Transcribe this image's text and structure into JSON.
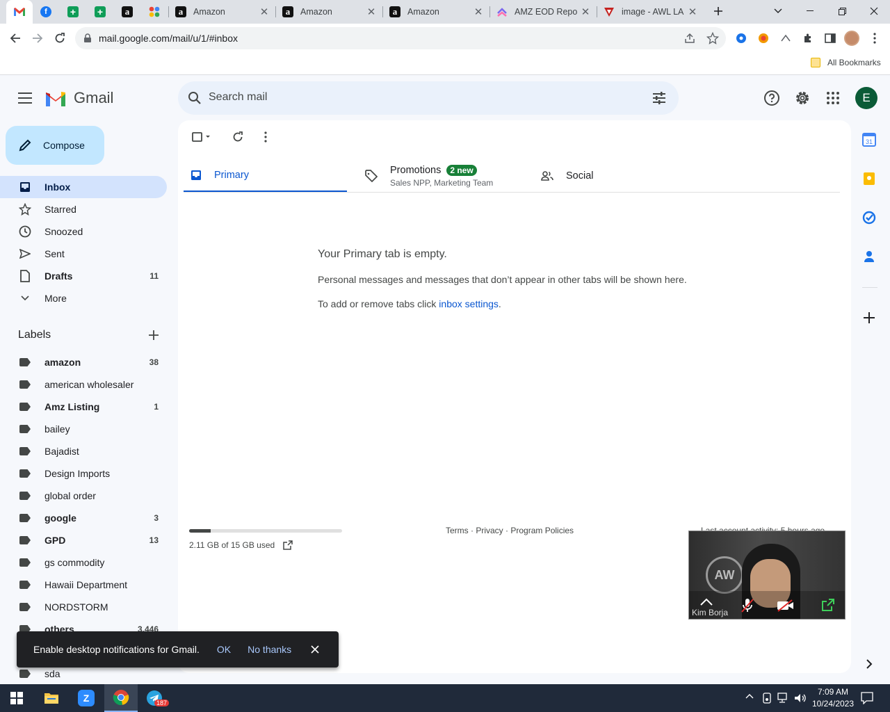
{
  "browser": {
    "tabs": [
      {
        "title": "Amazon",
        "icon": "amazon-icon"
      },
      {
        "title": "Amazon",
        "icon": "amazon-icon"
      },
      {
        "title": "Amazon",
        "icon": "amazon-icon"
      },
      {
        "title": "AMZ EOD Repo",
        "icon": "clickup-icon"
      },
      {
        "title": "image - AWL LA",
        "icon": "awl-icon"
      }
    ],
    "pinned_tabs": [
      "gmail-icon",
      "facebook-icon",
      "sheets-icon",
      "sheets-icon",
      "amazon-icon",
      "google-apps-icon"
    ],
    "url": "mail.google.com/mail/u/1/#inbox",
    "bookmarks_label": "All Bookmarks"
  },
  "gmail": {
    "logo_text": "Gmail",
    "search_placeholder": "Search mail",
    "avatar_letter": "E",
    "compose_label": "Compose",
    "nav": [
      {
        "label": "Inbox",
        "count": "",
        "icon": "inbox-icon",
        "active": true
      },
      {
        "label": "Starred",
        "count": "",
        "icon": "star-icon"
      },
      {
        "label": "Snoozed",
        "count": "",
        "icon": "clock-icon"
      },
      {
        "label": "Sent",
        "count": "",
        "icon": "send-icon"
      },
      {
        "label": "Drafts",
        "count": "11",
        "icon": "draft-icon",
        "bold": true
      },
      {
        "label": "More",
        "count": "",
        "icon": "chevron-down-icon"
      }
    ],
    "labels_title": "Labels",
    "labels": [
      {
        "label": "amazon",
        "count": "38",
        "bold": true
      },
      {
        "label": "american wholesaler",
        "count": ""
      },
      {
        "label": "Amz Listing",
        "count": "1",
        "bold": true
      },
      {
        "label": "bailey",
        "count": ""
      },
      {
        "label": "Bajadist",
        "count": ""
      },
      {
        "label": "Design Imports",
        "count": ""
      },
      {
        "label": "global order",
        "count": ""
      },
      {
        "label": "google",
        "count": "3",
        "bold": true
      },
      {
        "label": "GPD",
        "count": "13",
        "bold": true
      },
      {
        "label": "gs commodity",
        "count": ""
      },
      {
        "label": "Hawaii Department",
        "count": ""
      },
      {
        "label": "NORDSTORM",
        "count": ""
      },
      {
        "label": "others",
        "count": "3,446",
        "bold": true
      },
      {
        "label": "sda",
        "count": ""
      }
    ],
    "tabs": {
      "primary": "Primary",
      "promotions": "Promotions",
      "promotions_badge": "2 new",
      "promotions_sub": "Sales NPP, Marketing Team",
      "social": "Social"
    },
    "empty": {
      "title": "Your Primary tab is empty.",
      "desc": "Personal messages and messages that don’t appear in other tabs will be shown here.",
      "hint_prefix": "To add or remove tabs click ",
      "hint_link": "inbox settings",
      "hint_suffix": "."
    },
    "storage": {
      "text": "2.11 GB of 15 GB used",
      "fraction": 0.14
    },
    "footer": {
      "terms": "Terms",
      "privacy": "Privacy",
      "policies": "Program Policies",
      "sep": " · ",
      "activity": "Last account activity: 5 hours ago"
    }
  },
  "toast": {
    "message": "Enable desktop notifications for Gmail.",
    "ok": "OK",
    "no_thanks": "No thanks"
  },
  "zoom": {
    "name": "Kim Borja"
  },
  "taskbar": {
    "time": "7:09 AM",
    "date": "10/24/2023",
    "telegram_badge": "187"
  },
  "colors": {
    "accent": "#0b57d0",
    "primary_tab": "#0b57d0",
    "badge_green": "#188038",
    "gmail_red": "#ea4335",
    "avatar_bg": "#0b5b37"
  }
}
